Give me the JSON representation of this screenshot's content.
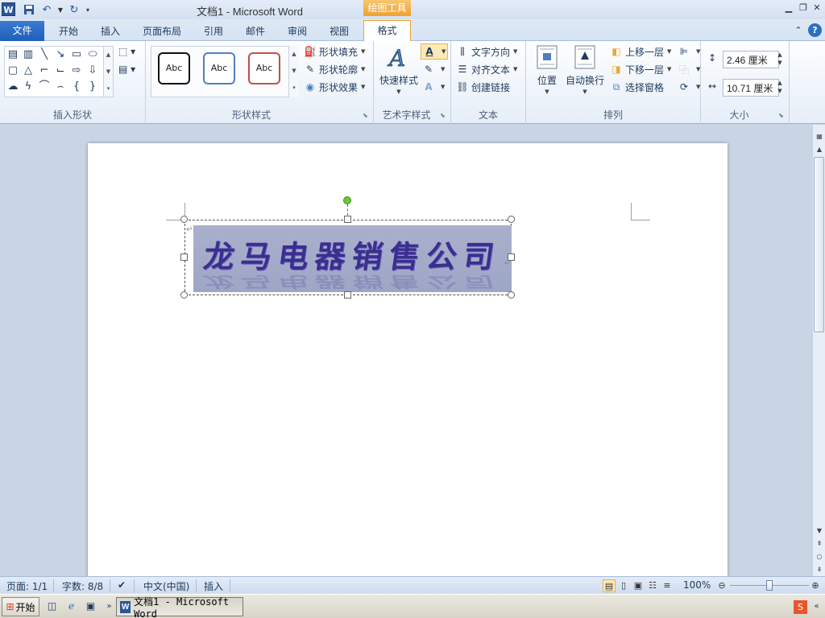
{
  "titlebar": {
    "app_icon": "W",
    "title": "文档1  -  Microsoft Word",
    "context_tab": "绘图工具"
  },
  "tabs": {
    "file": "文件",
    "items": [
      "开始",
      "插入",
      "页面布局",
      "引用",
      "邮件",
      "审阅",
      "视图",
      "格式"
    ],
    "active": "格式"
  },
  "ribbon": {
    "insert_shapes": {
      "label": "插入形状"
    },
    "shape_styles": {
      "label": "形状样式",
      "swatch_text": "Abc",
      "fill": "形状填充",
      "outline": "形状轮廓",
      "effects": "形状效果"
    },
    "wordart_styles": {
      "label": "艺术字样式",
      "quick_styles": "快速样式"
    },
    "text": {
      "label": "文本",
      "direction": "文字方向",
      "align": "对齐文本",
      "link": "创建链接"
    },
    "arrange": {
      "label": "排列",
      "position": "位置",
      "wrap": "自动换行",
      "bring_forward": "上移一层",
      "send_backward": "下移一层",
      "selection_pane": "选择窗格"
    },
    "size": {
      "label": "大小",
      "height": "2.46 厘米",
      "width": "10.71 厘米"
    }
  },
  "document": {
    "wordart_text": "龙马电器销售公司"
  },
  "statusbar": {
    "page": "页面: 1/1",
    "words": "字数: 8/8",
    "language": "中文(中国)",
    "mode": "插入",
    "zoom": "100%",
    "zoom_level": 1.0
  },
  "taskbar": {
    "start": "开始",
    "task": "文档1 - Microsoft Word"
  },
  "colors": {
    "accent": "#2b5797",
    "context_tab": "#f0a030",
    "wordart_text": "#3a2f8f",
    "wordart_fill": "#a4abca"
  }
}
